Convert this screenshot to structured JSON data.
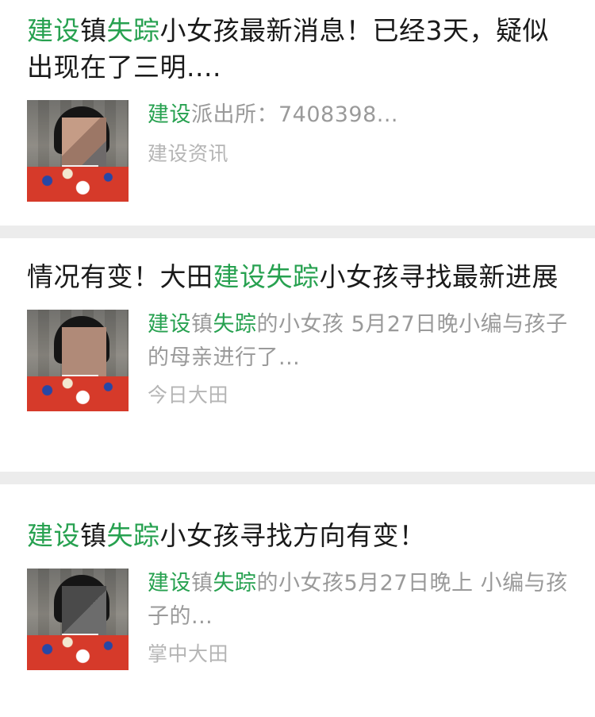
{
  "articles": [
    {
      "title_parts": [
        {
          "text": "建设",
          "hl": true
        },
        {
          "text": "镇",
          "hl": false
        },
        {
          "text": "失踪",
          "hl": true
        },
        {
          "text": "小女孩最新消息！已经3天，疑似出现在了三明....",
          "hl": false
        }
      ],
      "snippet_parts": [
        {
          "text": "建设",
          "hl": true
        },
        {
          "text": "派出所：7408398...",
          "hl": false
        }
      ],
      "source": "建设资讯"
    },
    {
      "title_parts": [
        {
          "text": "情况有变！大田",
          "hl": false
        },
        {
          "text": "建设",
          "hl": true
        },
        {
          "text": "失踪",
          "hl": true
        },
        {
          "text": "小女孩寻找最新进展",
          "hl": false
        }
      ],
      "snippet_parts": [
        {
          "text": "建设",
          "hl": true
        },
        {
          "text": "镇",
          "hl": false
        },
        {
          "text": "失踪",
          "hl": true
        },
        {
          "text": "的小女孩 5月27日晚小编与孩子的母亲进行了...",
          "hl": false
        }
      ],
      "source": "今日大田"
    },
    {
      "title_parts": [
        {
          "text": "建设",
          "hl": true
        },
        {
          "text": "镇",
          "hl": false
        },
        {
          "text": "失踪",
          "hl": true
        },
        {
          "text": "小女孩寻找方向有变！",
          "hl": false
        }
      ],
      "snippet_parts": [
        {
          "text": "建设",
          "hl": true
        },
        {
          "text": "镇",
          "hl": false
        },
        {
          "text": "失踪",
          "hl": true
        },
        {
          "text": "的小女孩5月27日晚上 小编与孩子的...",
          "hl": false
        }
      ],
      "source": "掌中大田"
    }
  ],
  "colors": {
    "highlight": "#27a150",
    "title": "#1a1a1a",
    "snippet": "#9a9a9a",
    "source": "#b5b5b5",
    "separator": "#ececec"
  }
}
